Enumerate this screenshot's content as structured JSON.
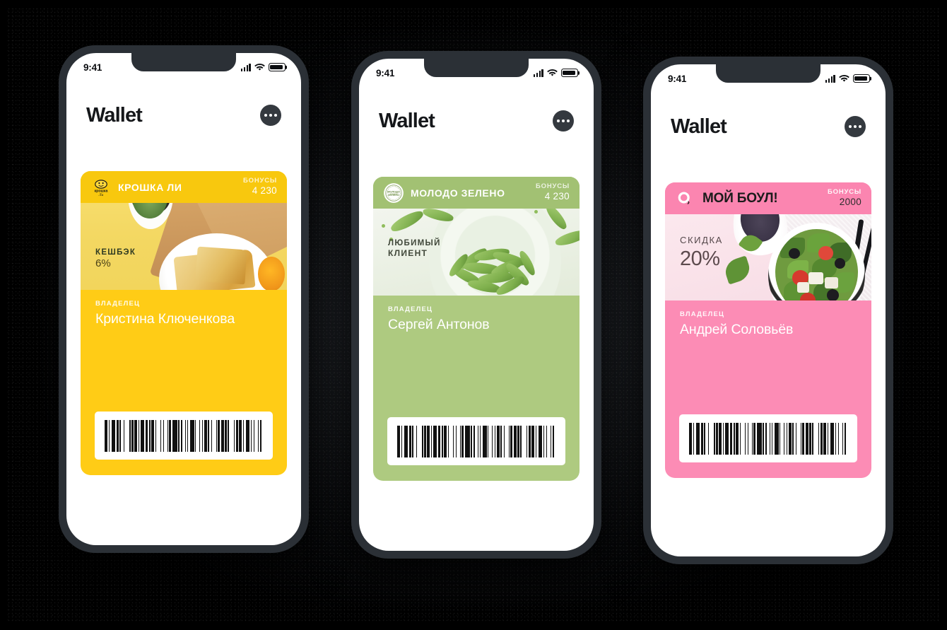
{
  "background": {
    "color": "#000000"
  },
  "phones": [
    {
      "id": "phone-1",
      "status_bar": {
        "time": "9:41",
        "signal_icon": "cellular-signal-icon",
        "wifi_icon": "wifi-icon",
        "battery_icon": "battery-icon"
      },
      "header": {
        "title": "Wallet",
        "more_button_icon": "more-options-icon"
      },
      "card": {
        "brand": "КРОШКА ЛИ",
        "logo_icon": "kroshka-li-logo-icon",
        "bonus_label": "БОНУСЫ",
        "bonus_value": "4 230",
        "badge_line1": "КЕШБЭК",
        "badge_line2": "6%",
        "owner_label": "ВЛАДЕЛЕЦ",
        "owner_name": "Кристина Ключенкова",
        "barcode_icon": "barcode-icon",
        "accent_color": "#FFCC16",
        "header_color": "#F8C80E"
      }
    },
    {
      "id": "phone-2",
      "status_bar": {
        "time": "9:41",
        "signal_icon": "cellular-signal-icon",
        "wifi_icon": "wifi-icon",
        "battery_icon": "battery-icon"
      },
      "header": {
        "title": "Wallet",
        "more_button_icon": "more-options-icon"
      },
      "card": {
        "brand": "МОЛОДО ЗЕЛЕНО",
        "logo_icon": "molodo-zeleno-logo-icon",
        "bonus_label": "БОНУСЫ",
        "bonus_value": "4 230",
        "badge_line1": "ЛЮБИМЫЙ",
        "badge_line2": "КЛИЕНТ",
        "owner_label": "ВЛАДЕЛЕЦ",
        "owner_name": "Сергей Антонов",
        "barcode_icon": "barcode-icon",
        "accent_color": "#AECA80",
        "header_color": "#A2C173"
      }
    },
    {
      "id": "phone-3",
      "status_bar": {
        "time": "9:41",
        "signal_icon": "cellular-signal-icon",
        "wifi_icon": "wifi-icon",
        "battery_icon": "battery-icon"
      },
      "header": {
        "title": "Wallet",
        "more_button_icon": "more-options-icon"
      },
      "card": {
        "brand": "МОЙ БОУЛ!",
        "logo_icon": "moy-boul-logo-icon",
        "bonus_label": "БОНУСЫ",
        "bonus_value": "2000",
        "badge_line1": "СКИДКА",
        "badge_line2": "20%",
        "owner_label": "ВЛАДЕЛЕЦ",
        "owner_name": "Андрей Соловьёв",
        "barcode_icon": "barcode-icon",
        "accent_color": "#FC8CB5",
        "header_color": "#FB85B0"
      }
    }
  ]
}
